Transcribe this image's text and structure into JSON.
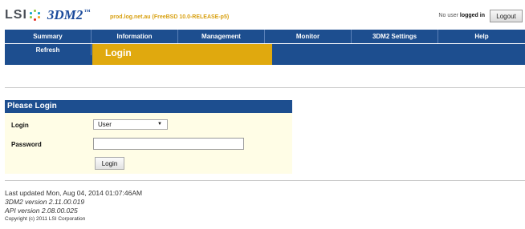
{
  "header": {
    "logo_lsi": "LSI",
    "logo_product": "3DM2",
    "logo_tm": "™",
    "host_info": "prod.log.net.au (FreeBSD 10.0-RELEASE-p5)",
    "user_status_prefix": "No user",
    "user_status_suffix": "logged in",
    "logout_label": "Logout"
  },
  "nav": {
    "tabs": [
      {
        "label": "Summary"
      },
      {
        "label": "Information"
      },
      {
        "label": "Management"
      },
      {
        "label": "Monitor"
      },
      {
        "label": "3DM2 Settings"
      },
      {
        "label": "Help"
      }
    ],
    "refresh_label": "Refresh",
    "page_title": "Login"
  },
  "login_form": {
    "header": "Please Login",
    "login_label": "Login",
    "login_select_value": "User",
    "password_label": "Password",
    "password_value": "",
    "submit_label": "Login"
  },
  "footer": {
    "last_updated": "Last updated Mon, Aug 04, 2014 01:07:46AM",
    "version_3dm2": "3DM2 version 2.11.00.019",
    "api_version": "API version 2.08.00.025",
    "copyright": "Copyright (c) 2011 LSI Corporation"
  },
  "colors": {
    "nav_blue": "#1d4e8f",
    "accent_gold": "#e0a90e",
    "panel_bg": "#fffde6"
  }
}
